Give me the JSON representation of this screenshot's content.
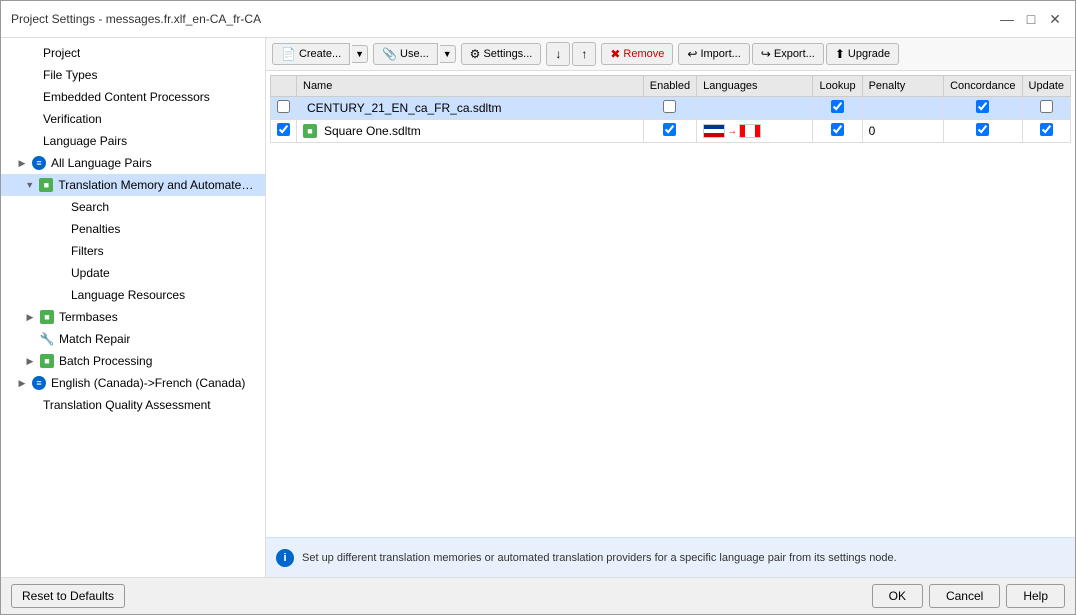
{
  "window": {
    "title": "Project Settings - messages.fr.xlf_en-CA_fr-CA"
  },
  "toolbar": {
    "create_label": "Create...",
    "use_label": "Use...",
    "settings_label": "Settings...",
    "remove_label": "Remove",
    "import_label": "Import...",
    "export_label": "Export...",
    "upgrade_label": "Upgrade"
  },
  "table": {
    "columns": [
      "",
      "Name",
      "Enabled",
      "Languages",
      "Lookup",
      "Penalty",
      "Concordance",
      "Update"
    ],
    "rows": [
      {
        "checked": false,
        "name": "CENTURY_21_EN_ca_FR_ca.sdltm",
        "enabled": false,
        "languages": "",
        "lookup": true,
        "penalty": "",
        "concordance": true,
        "update": false,
        "selected": true
      },
      {
        "checked": true,
        "name": "Square One.sdltm",
        "enabled": true,
        "languages": "flags",
        "lookup": true,
        "penalty": "0",
        "concordance": true,
        "update": true,
        "selected": false
      }
    ]
  },
  "info_message": "Set up different translation memories or automated translation providers for a specific language pair from its settings node.",
  "sidebar": {
    "items": [
      {
        "label": "Project",
        "level": 0,
        "icon": "none",
        "expand": ""
      },
      {
        "label": "File Types",
        "level": 0,
        "icon": "none",
        "expand": ""
      },
      {
        "label": "Embedded Content Processors",
        "level": 0,
        "icon": "none",
        "expand": ""
      },
      {
        "label": "Verification",
        "level": 0,
        "icon": "none",
        "expand": ""
      },
      {
        "label": "Language Pairs",
        "level": 0,
        "icon": "none",
        "expand": ""
      },
      {
        "label": "All Language Pairs",
        "level": 1,
        "icon": "blue-circle",
        "expand": "▶"
      },
      {
        "label": "Translation Memory and Automated Tr...",
        "level": 2,
        "icon": "green-square",
        "expand": "▼",
        "selected": true
      },
      {
        "label": "Search",
        "level": 3,
        "icon": "none",
        "expand": ""
      },
      {
        "label": "Penalties",
        "level": 3,
        "icon": "none",
        "expand": ""
      },
      {
        "label": "Filters",
        "level": 3,
        "icon": "none",
        "expand": ""
      },
      {
        "label": "Update",
        "level": 3,
        "icon": "none",
        "expand": ""
      },
      {
        "label": "Language Resources",
        "level": 3,
        "icon": "none",
        "expand": ""
      },
      {
        "label": "Termbases",
        "level": 2,
        "icon": "green-square",
        "expand": "▶"
      },
      {
        "label": "Match Repair",
        "level": 2,
        "icon": "orange-wrench",
        "expand": ""
      },
      {
        "label": "Batch Processing",
        "level": 2,
        "icon": "green-square",
        "expand": "▶"
      },
      {
        "label": "English (Canada)->French (Canada)",
        "level": 1,
        "icon": "blue-circle",
        "expand": "▶"
      },
      {
        "label": "Translation Quality Assessment",
        "level": 0,
        "icon": "none",
        "expand": ""
      }
    ]
  },
  "buttons": {
    "reset": "Reset to Defaults",
    "ok": "OK",
    "cancel": "Cancel",
    "help": "Help"
  }
}
